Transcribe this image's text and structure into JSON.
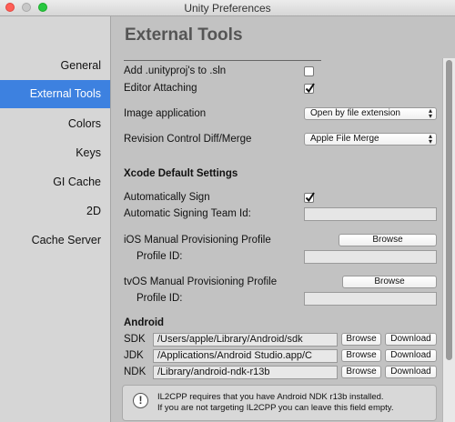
{
  "window": {
    "title": "Unity Preferences"
  },
  "sidebar": {
    "items": [
      {
        "label": "General"
      },
      {
        "label": "External Tools"
      },
      {
        "label": "Colors"
      },
      {
        "label": "Keys"
      },
      {
        "label": "GI Cache"
      },
      {
        "label": "2D"
      },
      {
        "label": "Cache Server"
      }
    ],
    "active_index": 1,
    "active_color": "#3d81e0"
  },
  "main": {
    "header": "External Tools",
    "add_unityproj": {
      "label": "Add .unityproj's to .sln",
      "checked": false
    },
    "editor_attaching": {
      "label": "Editor Attaching",
      "checked": true
    },
    "image_application": {
      "label": "Image application",
      "value": "Open by file extension"
    },
    "revision_control": {
      "label": "Revision Control Diff/Merge",
      "value": "Apple File Merge"
    },
    "xcode": {
      "section_title": "Xcode Default Settings",
      "auto_sign": {
        "label": "Automatically Sign",
        "checked": true
      },
      "team_id": {
        "label": "Automatic Signing Team Id:",
        "value": ""
      },
      "ios_profile": {
        "label": "iOS Manual Provisioning Profile",
        "button": "Browse",
        "profile_id_label": "Profile ID:",
        "profile_id": ""
      },
      "tvos_profile": {
        "label": "tvOS Manual Provisioning Profile",
        "button": "Browse",
        "profile_id_label": "Profile ID:",
        "profile_id": ""
      }
    },
    "android": {
      "section_title": "Android",
      "sdk": {
        "label": "SDK",
        "path": "/Users/apple/Library/Android/sdk",
        "browse": "Browse",
        "download": "Download"
      },
      "jdk": {
        "label": "JDK",
        "path": "/Applications/Android Studio.app/C",
        "browse": "Browse",
        "download": "Download"
      },
      "ndk": {
        "label": "NDK",
        "path": "/Library/android-ndk-r13b",
        "browse": "Browse",
        "download": "Download"
      },
      "help": {
        "icon": "info-icon",
        "line1": "IL2CPP requires that you have Android NDK r13b installed.",
        "line2": "If you are not targeting IL2CPP you can leave this field empty."
      }
    }
  }
}
